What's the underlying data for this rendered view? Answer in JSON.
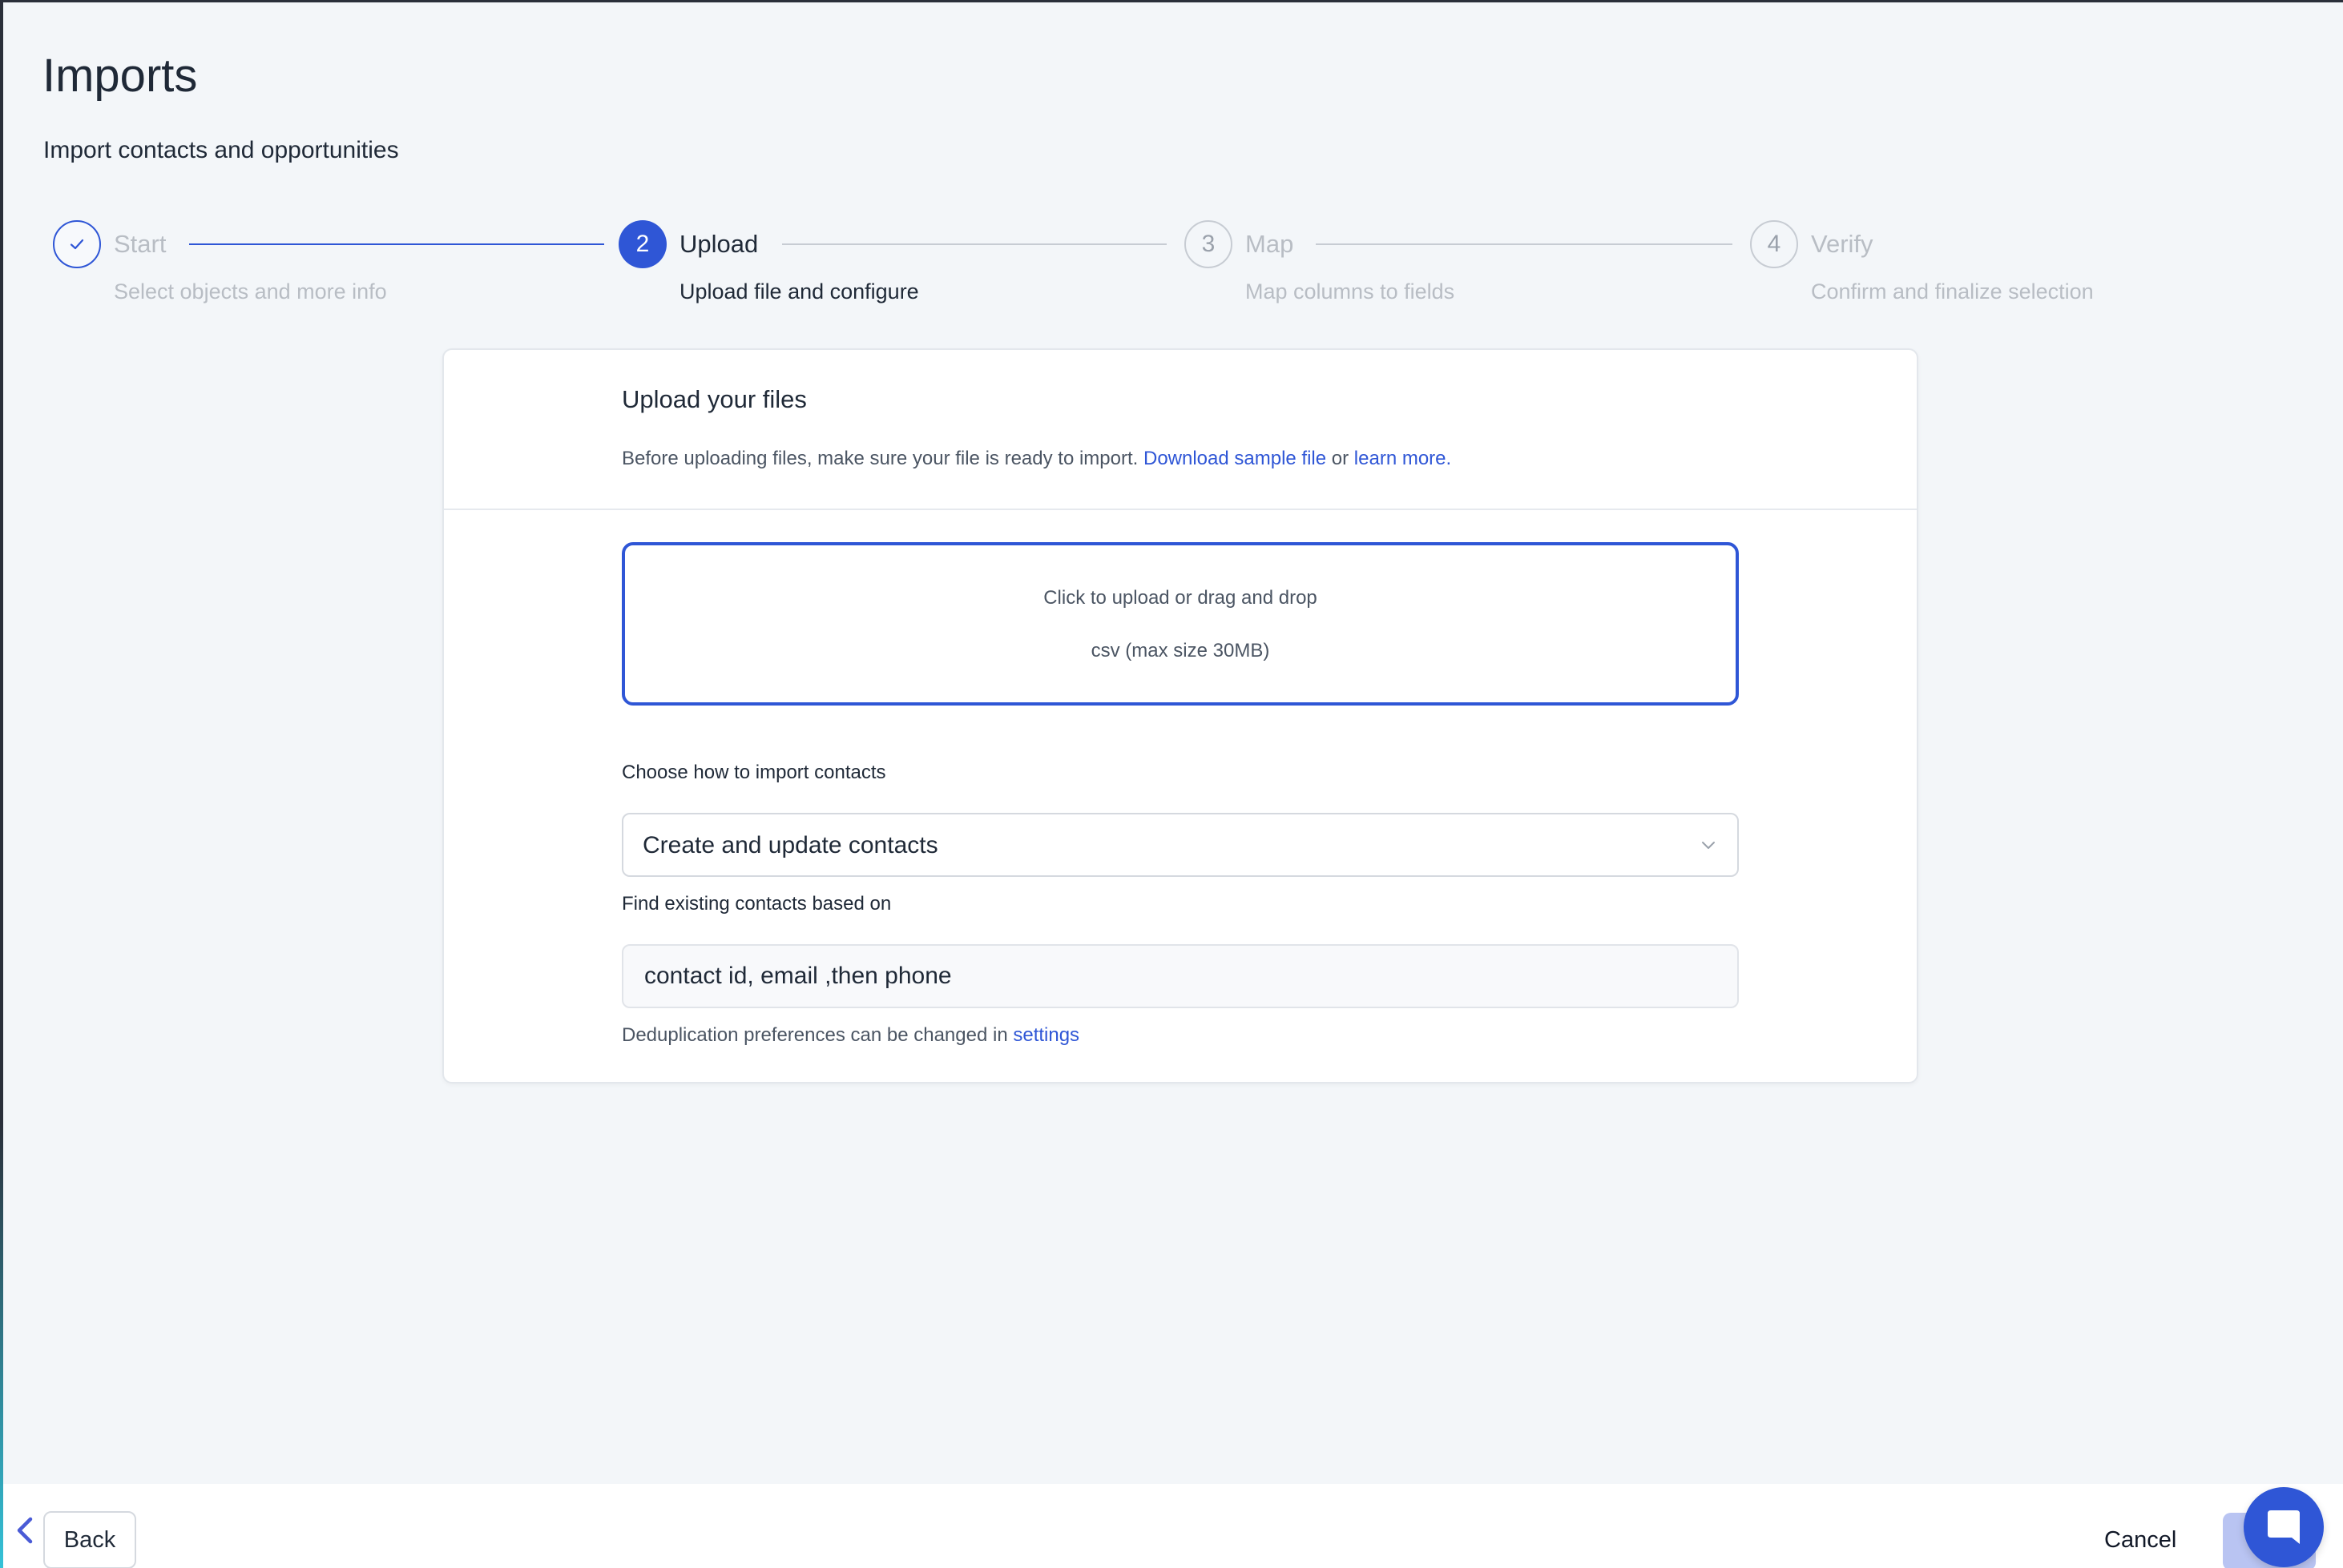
{
  "header": {
    "title": "Imports",
    "subtitle": "Import contacts and opportunities"
  },
  "stepper": {
    "steps": [
      {
        "number": "",
        "label": "Start",
        "description": "Select objects and more info",
        "state": "completed"
      },
      {
        "number": "2",
        "label": "Upload",
        "description": "Upload file and configure",
        "state": "active"
      },
      {
        "number": "3",
        "label": "Map",
        "description": "Map columns to fields",
        "state": "pending"
      },
      {
        "number": "4",
        "label": "Verify",
        "description": "Confirm and finalize selection",
        "state": "pending"
      }
    ]
  },
  "card": {
    "title": "Upload your files",
    "description_prefix": "Before uploading files, make sure your file is ready to import. ",
    "download_link": "Download sample file",
    "description_or": " or ",
    "learn_more_link": "learn more.",
    "dropzone": {
      "primary": "Click to upload or drag and drop",
      "secondary": "csv (max size 30MB)"
    },
    "import_mode": {
      "label": "Choose how to import contacts",
      "selected": "Create and update contacts"
    },
    "dedupe": {
      "label": "Find existing contacts based on",
      "value": "contact id, email ,then phone",
      "help_prefix": "Deduplication preferences can be changed in ",
      "settings_link": "settings"
    }
  },
  "footer": {
    "back_label": "Back",
    "cancel_label": "Cancel"
  },
  "colors": {
    "accent": "#2f56d6",
    "background": "#f3f6f9",
    "muted_text": "#b8bdc4",
    "next_button_disabled": "#b9c4f2"
  },
  "icons": {
    "step_done": "check-icon",
    "select": "chevron-down-icon",
    "back": "chevron-left-icon",
    "chat": "chat-bubble-icon"
  }
}
